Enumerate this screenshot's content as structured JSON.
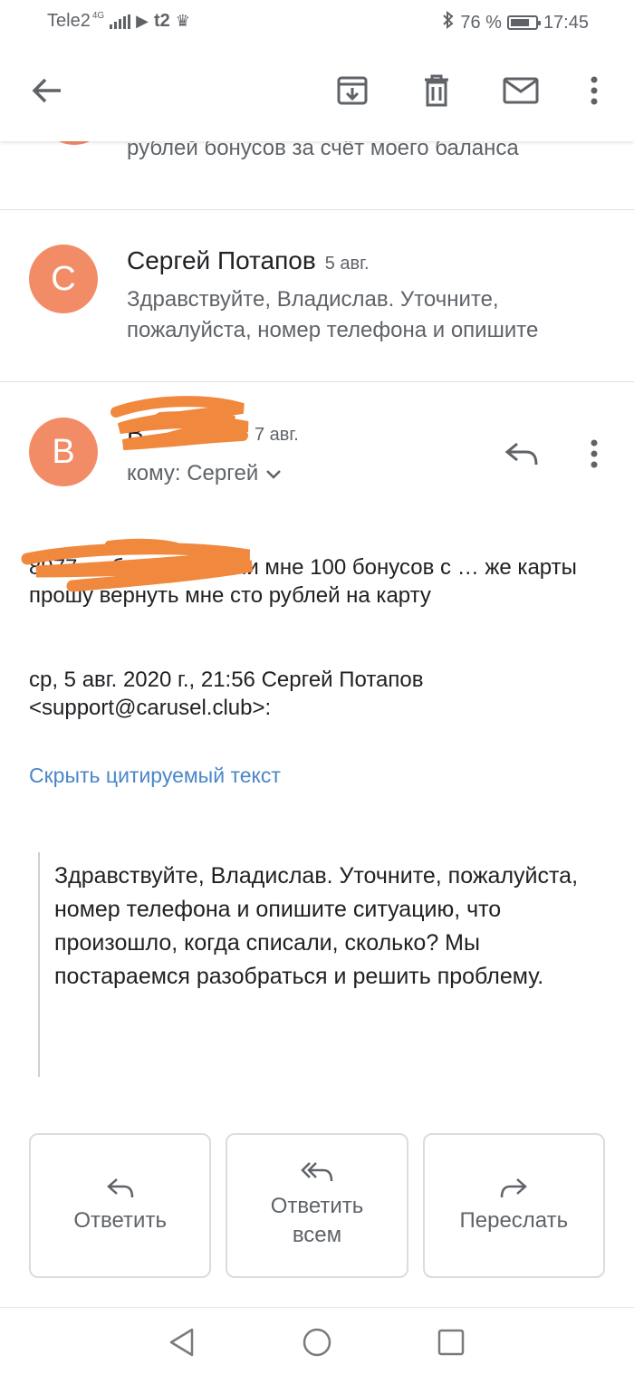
{
  "status_bar": {
    "carrier": "Tele2",
    "network": "4G",
    "carrier2": "t2",
    "battery_percent": "76 %",
    "battery_level": 0.76,
    "time": "17:45"
  },
  "app_bar": {
    "icons": [
      "back-arrow-icon",
      "archive-icon",
      "delete-icon",
      "mark-unread-icon",
      "more-vert-icon"
    ]
  },
  "thread": {
    "top_snippet": "рублей бонусов за счёт моего баланса",
    "messages": [
      {
        "avatar_letter": "С",
        "avatar_color": "#f28c66",
        "sender": "Сергей Потапов",
        "date": "5 авг.",
        "snippet": "Здравствуйте, Владислав. Уточните, пожалуйста, номер телефона и опишите"
      },
      {
        "avatar_letter": "В",
        "avatar_color": "#f28c66",
        "date": "7 авг.",
        "to_label": "кому: Сергей",
        "body": "8977 … бот начислили мне 100 бонусов с … же карты прошу вернуть мне сто рублей на карту",
        "quote_header": "ср, 5 авг. 2020 г., 21:56 Сергей Потапов <support@carusel.club>:",
        "hide_quoted_label": "Скрыть цитируемый текст",
        "quoted_text": "Здравствуйте, Владислав. Уточните, пожалуйста, номер телефона и опишите ситуацию, что произошло, когда списали, сколько? Мы постараемся разобраться и решить проблему."
      }
    ]
  },
  "actions": {
    "reply": "Ответить",
    "reply_all": "Ответить всем",
    "forward": "Переслать"
  },
  "colors": {
    "accent_link": "#4a86c8",
    "avatar": "#f28c66",
    "redaction": "#f0883e"
  }
}
